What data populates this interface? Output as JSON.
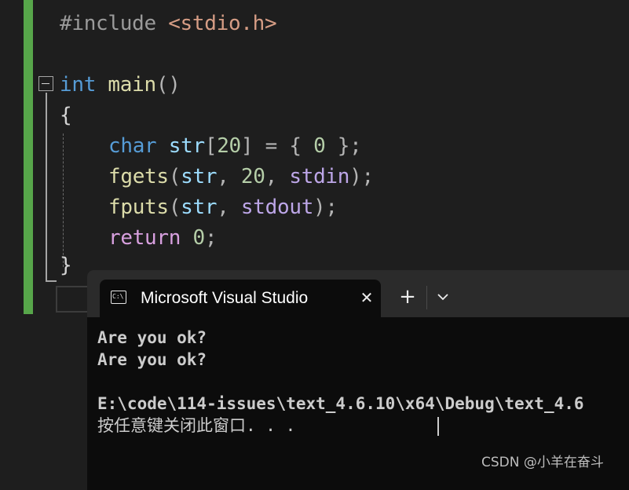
{
  "editor": {
    "line1": {
      "directive": "#include",
      "space": " ",
      "header": "<stdio.h>"
    },
    "line3": {
      "keyword": "int",
      "space": " ",
      "func": "main",
      "parens": "()"
    },
    "line4": {
      "brace": "{"
    },
    "line5": {
      "type": "char",
      "s1": " ",
      "var": "str",
      "open": "[",
      "num": "20",
      "close": "]",
      "eq": " = ",
      "lb": "{ ",
      "zero": "0",
      "rb": " };"
    },
    "line6": {
      "func": "fgets",
      "open": "(",
      "arg1": "str",
      "c1": ", ",
      "num": "20",
      "c2": ", ",
      "arg3": "stdin",
      "close": ");"
    },
    "line7": {
      "func": "fputs",
      "open": "(",
      "arg1": "str",
      "c1": ", ",
      "arg2": "stdout",
      "close": ");"
    },
    "line8": {
      "keyword": "return",
      "space": " ",
      "num": "0",
      "semi": ";"
    },
    "line9": {
      "brace": "}"
    }
  },
  "terminal": {
    "tab_title": "Microsoft Visual Studio",
    "tab_icon": "C:\\",
    "close_glyph": "✕",
    "new_tab_glyph": "+",
    "output": [
      "Are you ok?",
      "Are you ok?",
      "",
      "E:\\code\\114-issues\\text_4.6.10\\x64\\Debug\\text_4.6",
      "按任意键关闭此窗口. . ."
    ]
  },
  "watermark": "CSDN @小羊在奋斗",
  "colors": {
    "editor_bg": "#1e1e1e",
    "change_bar": "#57a64a",
    "keyword": "#569cd6",
    "function": "#dcdcaa",
    "string": "#d69d85",
    "number": "#b5cea8",
    "variable": "#9cdcfe",
    "terminal_bg": "#0c0c0c",
    "tab_bar": "#2b2b2b"
  },
  "icons": [
    "fold-collapse-icon",
    "terminal-app-icon",
    "close-icon",
    "plus-icon",
    "chevron-down-icon"
  ]
}
